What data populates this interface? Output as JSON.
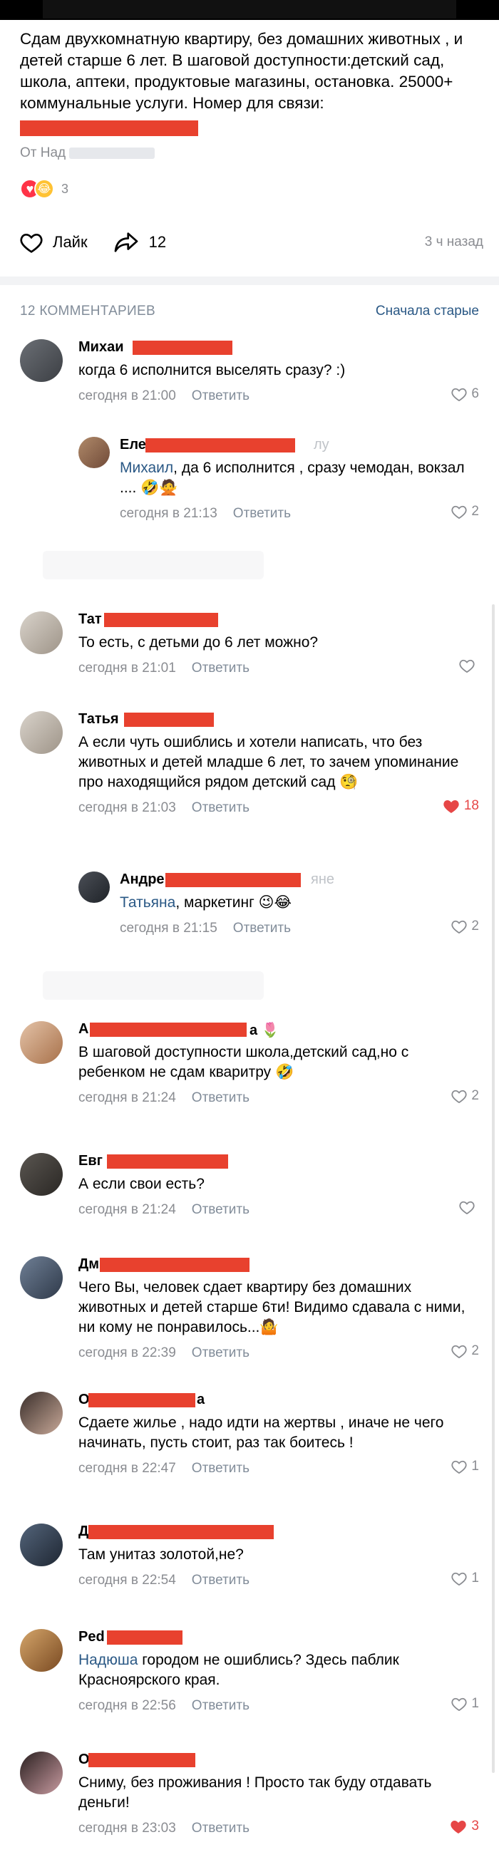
{
  "post": {
    "text": "Сдам двухкомнатную квартиру, без домашних животных , и детей старше 6 лет. В шаговой доступности:детский сад, школа, аптеки, продуктовые магазины, остановка. 25000+ коммунальные услуги. Номер для связи:",
    "from_label": "От Над",
    "reaction_count": "3",
    "like_label": "Лайк",
    "share_count": "12",
    "time_ago": "3 ч назад"
  },
  "comments_header": {
    "count_label": "12 КОММЕНТАРИЕВ",
    "sort_label": "Сначала старые"
  },
  "reply_label": "Ответить",
  "comments": [
    {
      "name": "Михаи",
      "text": "когда 6 исполнится выселять сразу? :)",
      "time": "сегодня в 21:00",
      "likes": "6",
      "liked": false
    },
    {
      "name": "Еле",
      "name_tail": "лу",
      "mention": "Михаил",
      "text": ", да 6 исполнится , сразу чемодан, вокзал .... 🤣🙅",
      "time": "сегодня в 21:13",
      "likes": "2",
      "liked": false
    },
    {
      "name": "Тат",
      "text": "То есть, с детьми до 6 лет можно?",
      "time": "сегодня в 21:01",
      "likes": "",
      "liked": false
    },
    {
      "name": "Татья",
      "text": "А если чуть ошиблись и хотели написать, что без животных и детей младше 6 лет, то зачем упоминание про находящийся рядом детский сад 🧐",
      "time": "сегодня в 21:03",
      "likes": "18",
      "liked": true
    },
    {
      "name": "Андре",
      "name_tail": "яне",
      "mention": "Татьяна",
      "text": ", маркетинг 😉😂",
      "time": "сегодня в 21:15",
      "likes": "2",
      "liked": false
    },
    {
      "name": "А",
      "name_tail": "а 🌷",
      "text": "В шаговой доступности школа,детский сад,но с ребенком не сдам кваритру 🤣",
      "time": "сегодня в 21:24",
      "likes": "2",
      "liked": false
    },
    {
      "name": "Евг",
      "text": "А если свои есть?",
      "time": "сегодня в 21:24",
      "likes": "",
      "liked": false
    },
    {
      "name": "Дм",
      "text": "Чего Вы, человек сдает квартиру без домашних животных и детей старше 6ти! Видимо сдавала с ними, ни кому не понравилось...🤷",
      "time": "сегодня в 22:39",
      "likes": "2",
      "liked": false
    },
    {
      "name": "О",
      "name_tail": "а",
      "text": "Сдаете жилье , надо идти на жертвы , иначе не чего начинать, пусть стоит, раз так боитесь !",
      "time": "сегодня в 22:47",
      "likes": "1",
      "liked": false
    },
    {
      "name": "Д",
      "text": "Там унитаз золотой,не?",
      "time": "сегодня в 22:54",
      "likes": "1",
      "liked": false
    },
    {
      "name": "Ped",
      "mention": "Надюша",
      "text": " городом не ошиблись? Здесь паблик Красноярского края.",
      "time": "сегодня в 22:56",
      "likes": "1",
      "liked": false
    },
    {
      "name": "О",
      "text": "Сниму, без проживания ! Просто так буду отдавать деньги!",
      "time": "сегодня в 23:03",
      "likes": "3",
      "liked": true
    }
  ],
  "colors": {
    "accent": "#2a5885",
    "like_red": "#e64646",
    "redaction": "#e8412e",
    "meta": "#8a8c91"
  }
}
